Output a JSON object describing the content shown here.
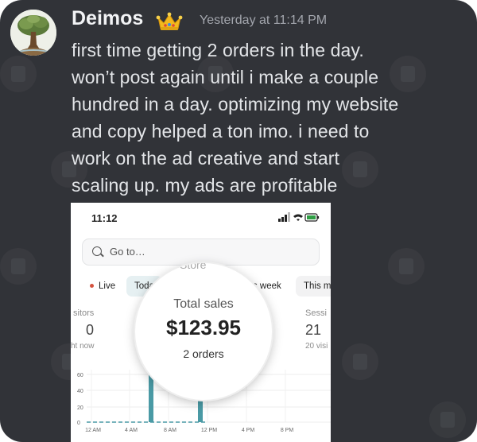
{
  "message": {
    "author": "Deimos",
    "author_badge_icon": "crown-icon",
    "timestamp": "Yesterday at 11:14 PM",
    "lines": [
      "first time getting 2 orders in the day.",
      "won’t post again until i make a couple",
      "hundred in a day. optimizing my website",
      "and copy helped a ton imo. i need to",
      "work on the ad creative and start",
      "scaling up. my ads are profitable"
    ]
  },
  "screenshot": {
    "status_time": "11:12",
    "status_icons": "▂▃▅ ≈ ▭",
    "search_placeholder": "Go to…",
    "chips": {
      "live": "Live",
      "today": "Toda",
      "this_week": "his week",
      "this_month": "This m"
    },
    "stats": {
      "visitors_label": "sitors",
      "visitors_value": "0",
      "visitors_sub": "ht now",
      "sessions_label": "Sessi",
      "sessions_value": "21",
      "sessions_sub": "20 visi"
    },
    "magnifier": {
      "partial_heading": "Store",
      "title": "Total sales",
      "amount": "$123.95",
      "orders": "2 orders"
    },
    "chart_data": {
      "type": "bar",
      "y_ticks": [
        "60",
        "40",
        "20",
        "0"
      ],
      "x_ticks": [
        "12 AM",
        "4 AM",
        "8 AM",
        "12 PM",
        "4 PM",
        "8 PM"
      ],
      "bar_color": "#4a9aa5"
    }
  }
}
